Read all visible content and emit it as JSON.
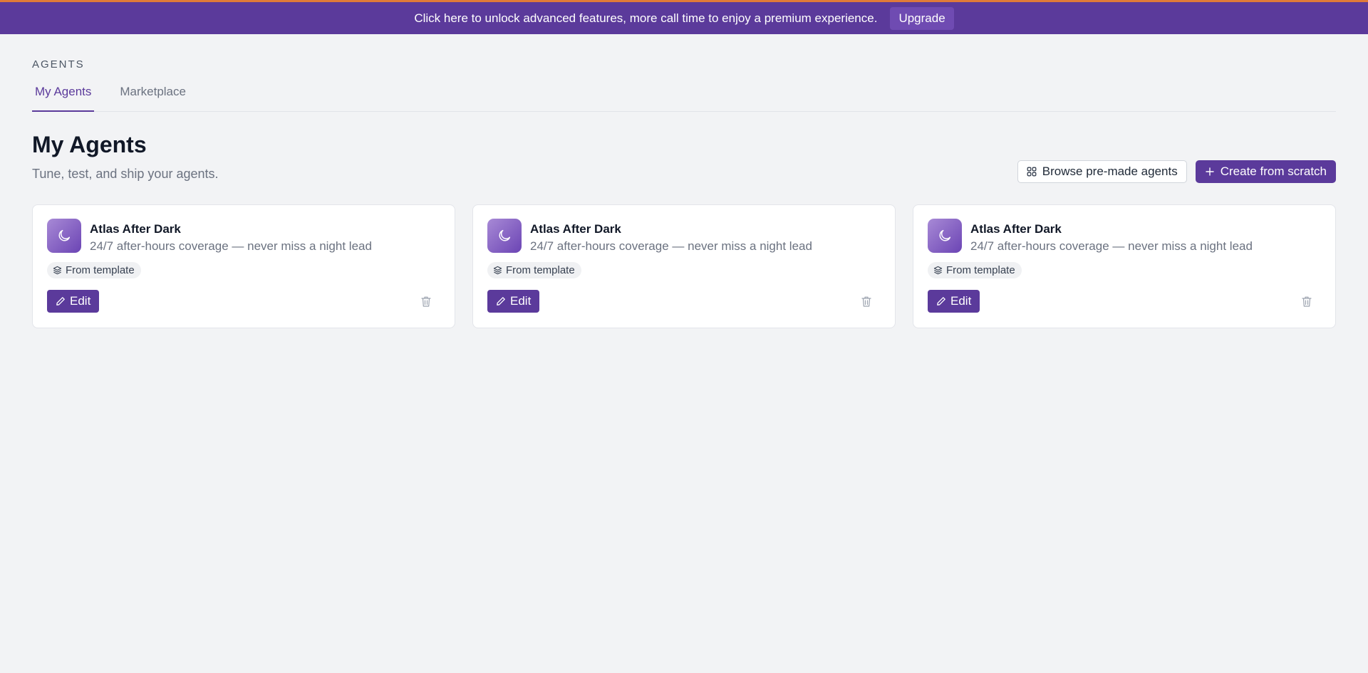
{
  "banner": {
    "message": "Click here to unlock advanced features, more call time to enjoy a premium experience.",
    "upgrade_label": "Upgrade",
    "bg_color": "#5b3a9b",
    "accent_border_color": "#e07b39"
  },
  "section_label": "AGENTS",
  "tabs": [
    {
      "label": "My Agents",
      "active": true
    },
    {
      "label": "Marketplace",
      "active": false
    }
  ],
  "header": {
    "title": "My Agents",
    "subtitle": "Tune, test, and ship your agents."
  },
  "actions": {
    "browse_label": "Browse pre-made agents",
    "browse_icon": "grid-icon",
    "create_label": "Create from scratch",
    "create_icon": "plus-icon"
  },
  "agents": [
    {
      "name": "Atlas After Dark",
      "description": "24/7 after-hours coverage — never miss a night lead",
      "badge": "From template",
      "icon": "moon-icon",
      "edit_label": "Edit"
    },
    {
      "name": "Atlas After Dark",
      "description": "24/7 after-hours coverage — never miss a night lead",
      "badge": "From template",
      "icon": "moon-icon",
      "edit_label": "Edit"
    },
    {
      "name": "Atlas After Dark",
      "description": "24/7 after-hours coverage — never miss a night lead",
      "badge": "From template",
      "icon": "moon-icon",
      "edit_label": "Edit"
    }
  ],
  "colors": {
    "primary": "#5b3a9b",
    "background": "#f2f3f5"
  }
}
